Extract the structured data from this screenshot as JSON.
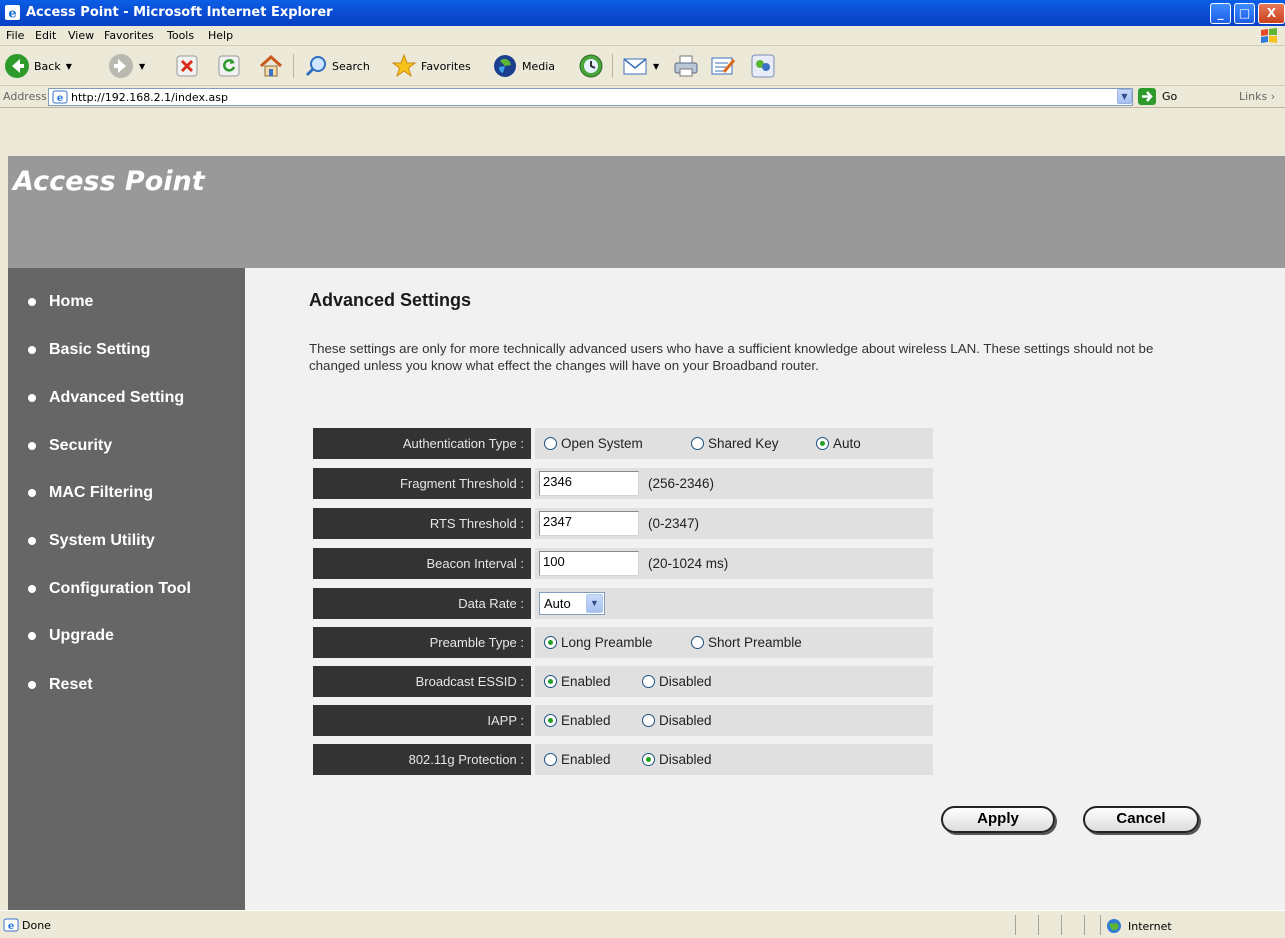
{
  "window": {
    "title": "Access Point - Microsoft Internet Explorer",
    "controls": [
      "_",
      "□",
      "X"
    ]
  },
  "menu": [
    "File",
    "Edit",
    "View",
    "Favorites",
    "Tools",
    "Help"
  ],
  "toolbar": {
    "back": "Back",
    "search": "Search",
    "favorites": "Favorites",
    "media": "Media"
  },
  "address": {
    "label": "Address",
    "url": "http://192.168.2.1/index.asp",
    "go": "Go",
    "links": "Links"
  },
  "page": {
    "brand": "Access Point",
    "nav": [
      "Home",
      "Basic Setting",
      "Advanced Setting",
      "Security",
      "MAC Filtering",
      "System Utility",
      "Configuration Tool",
      "Upgrade",
      "Reset"
    ],
    "heading": "Advanced Settings",
    "description": "These settings are only for more technically advanced users who have a sufficient knowledge about wireless LAN. These settings should not be changed unless you know what effect the changes will have on your Broadband router.",
    "auth": {
      "label": "Authentication Type :",
      "options": [
        "Open System",
        "Shared Key",
        "Auto"
      ],
      "selected": "Auto"
    },
    "fragment": {
      "label": "Fragment Threshold :",
      "value": "2346",
      "range": "(256-2346)"
    },
    "rts": {
      "label": "RTS Threshold :",
      "value": "2347",
      "range": "(0-2347)"
    },
    "beacon": {
      "label": "Beacon Interval :",
      "value": "100",
      "range": "(20-1024 ms)"
    },
    "data_rate": {
      "label": "Data Rate :",
      "value": "Auto"
    },
    "preamble": {
      "label": "Preamble Type :",
      "options": [
        "Long Preamble",
        "Short Preamble"
      ],
      "selected": "Long Preamble"
    },
    "essid": {
      "label": "Broadcast ESSID :",
      "options": [
        "Enabled",
        "Disabled"
      ],
      "selected": "Enabled"
    },
    "iapp": {
      "label": "IAPP :",
      "options": [
        "Enabled",
        "Disabled"
      ],
      "selected": "Enabled"
    },
    "protection": {
      "label": "802.11g Protection :",
      "options": [
        "Enabled",
        "Disabled"
      ],
      "selected": "Disabled"
    },
    "apply": "Apply",
    "cancel": "Cancel"
  },
  "status": {
    "text": "Done",
    "zone": "Internet"
  }
}
